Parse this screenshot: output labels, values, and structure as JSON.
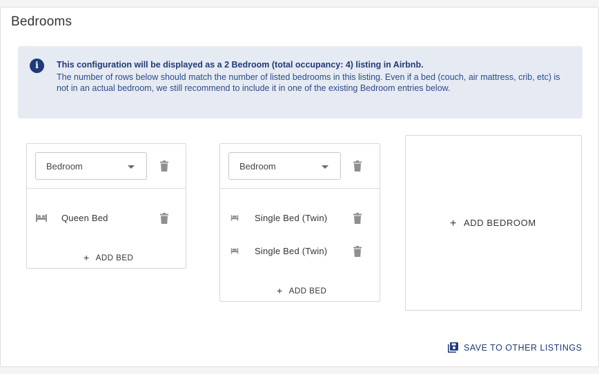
{
  "section": {
    "title": "Bedrooms"
  },
  "info": {
    "headline": "This configuration will be displayed as a 2 Bedroom (total occupancy: 4) listing in Airbnb.",
    "body": "The number of rows below should match the number of listed bedrooms in this listing. Even if a bed (couch, air mattress, crib, etc) is not in an actual bedroom, we still recommend to include it in one of the existing Bedroom entries below.",
    "icon": "info-icon"
  },
  "bedrooms": [
    {
      "type": "Bedroom",
      "beds": [
        {
          "label": "Queen Bed",
          "icon": "queen-bed-icon"
        }
      ],
      "add_bed_label": "ADD BED"
    },
    {
      "type": "Bedroom",
      "beds": [
        {
          "label": "Single Bed (Twin)",
          "icon": "single-bed-icon"
        },
        {
          "label": "Single Bed (Twin)",
          "icon": "single-bed-icon"
        }
      ],
      "add_bed_label": "ADD BED"
    }
  ],
  "add_bedroom_label": "ADD BEDROOM",
  "save_label": "SAVE TO OTHER LISTINGS",
  "colors": {
    "accent": "#1f3a78",
    "info_bg": "#e6eaf3",
    "info_text": "#2a4c8a",
    "icon_gray": "#8f8f8f"
  }
}
